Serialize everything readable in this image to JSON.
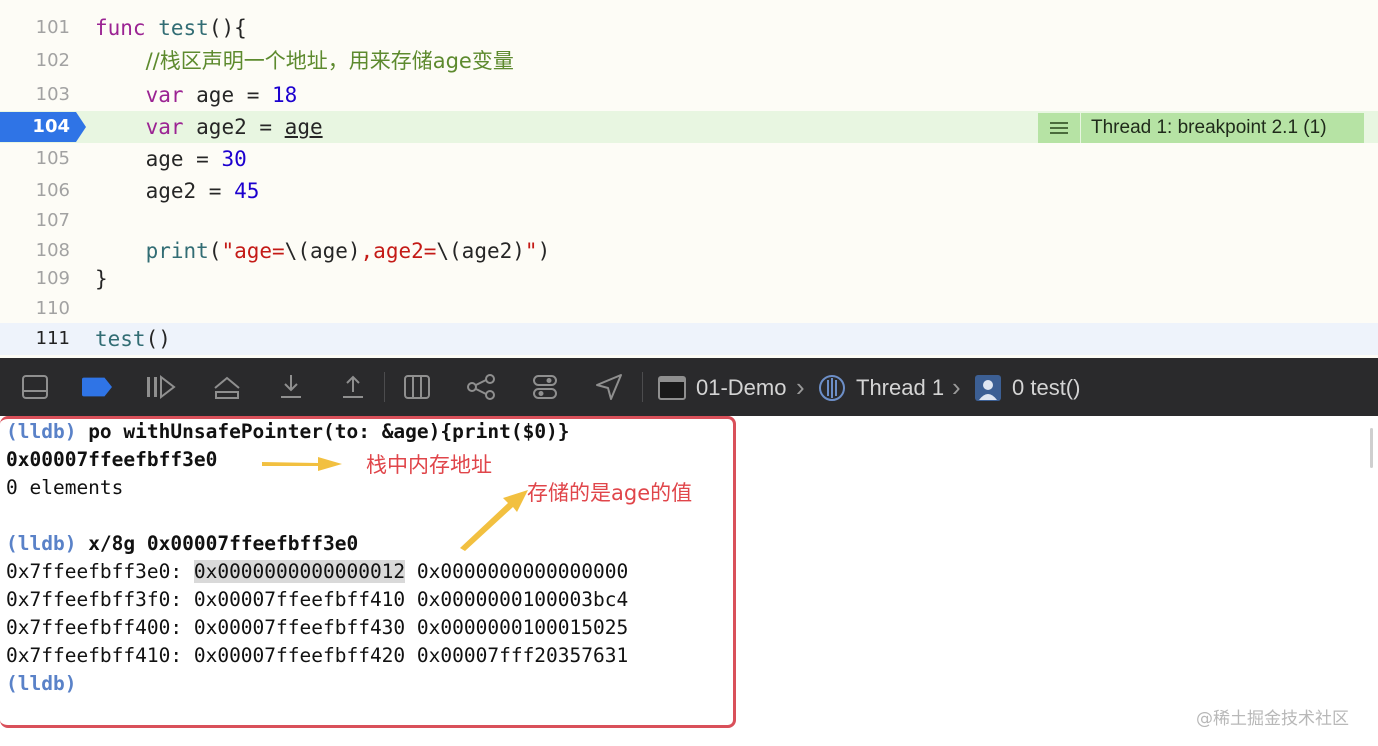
{
  "editor": {
    "lines": [
      {
        "num": "101",
        "tokens": [
          {
            "t": "func",
            "c": "kw"
          },
          {
            "t": " "
          },
          {
            "t": "test",
            "c": "fn"
          },
          {
            "t": "(){"
          }
        ]
      },
      {
        "num": "102",
        "tokens": [
          {
            "t": "    "
          },
          {
            "t": "//栈区声明一个地址，用来存储age变量",
            "c": "cm"
          }
        ]
      },
      {
        "num": "103",
        "tokens": [
          {
            "t": "    "
          },
          {
            "t": "var",
            "c": "kw"
          },
          {
            "t": " age = "
          },
          {
            "t": "18",
            "c": "num"
          }
        ]
      },
      {
        "num": "104",
        "tokens": [
          {
            "t": "    "
          },
          {
            "t": "var",
            "c": "kw"
          },
          {
            "t": " age2 = "
          },
          {
            "t": "age",
            "c": "ul"
          }
        ]
      },
      {
        "num": "105",
        "tokens": [
          {
            "t": "    age = "
          },
          {
            "t": "30",
            "c": "num"
          }
        ]
      },
      {
        "num": "106",
        "tokens": [
          {
            "t": "    age2 = "
          },
          {
            "t": "45",
            "c": "num"
          }
        ]
      },
      {
        "num": "107",
        "tokens": []
      },
      {
        "num": "108",
        "tokens": [
          {
            "t": "    "
          },
          {
            "t": "print",
            "c": "fn"
          },
          {
            "t": "("
          },
          {
            "t": "\"age=",
            "c": "str"
          },
          {
            "t": "\\(age)"
          },
          {
            "t": ",age2=",
            "c": "str"
          },
          {
            "t": "\\(age2)"
          },
          {
            "t": "\"",
            "c": "str"
          },
          {
            "t": ")"
          }
        ]
      },
      {
        "num": "109",
        "tokens": [
          {
            "t": "}"
          }
        ]
      },
      {
        "num": "110",
        "tokens": []
      },
      {
        "num": "111",
        "tokens": [
          {
            "t": "test",
            "c": "fn"
          },
          {
            "t": "()"
          }
        ]
      }
    ],
    "breakpoint_line": "104",
    "breakpoint_label": "Thread 1: breakpoint 2.1 (1)"
  },
  "toolbar": {
    "crumbs": [
      {
        "label": "01-Demo",
        "icon": "terminal-app-icon"
      },
      {
        "label": "Thread 1",
        "icon": "thread-icon"
      },
      {
        "label": "0 test()",
        "icon": "user-frame-icon"
      }
    ]
  },
  "console": {
    "lines": [
      {
        "prompt": "(lldb)",
        "text": " po withUnsafePointer(to: &age){print($0)}",
        "bold": true
      },
      {
        "text": "0x00007ffeefbff3e0",
        "bold": true
      },
      {
        "text": "0 elements"
      },
      {
        "text": ""
      },
      {
        "prompt": "(lldb)",
        "text": " x/8g 0x00007ffeefbff3e0",
        "bold": true
      },
      {
        "addr": "0x7ffeefbff3e0:",
        "v1": "0x0000000000000012",
        "v2": "0x0000000000000000",
        "sel": true
      },
      {
        "addr": "0x7ffeefbff3f0:",
        "v1": "0x00007ffeefbff410",
        "v2": "0x0000000100003bc4"
      },
      {
        "addr": "0x7ffeefbff400:",
        "v1": "0x00007ffeefbff430",
        "v2": "0x0000000100015025"
      },
      {
        "addr": "0x7ffeefbff410:",
        "v1": "0x00007ffeefbff420",
        "v2": "0x00007fff20357631"
      },
      {
        "prompt": "(lldb)",
        "text": ""
      }
    ]
  },
  "annotations": {
    "note1": "栈中内存地址",
    "note2": "存储的是age的值",
    "color": "#e0454a"
  },
  "watermark": "@稀土掘金技术社区"
}
